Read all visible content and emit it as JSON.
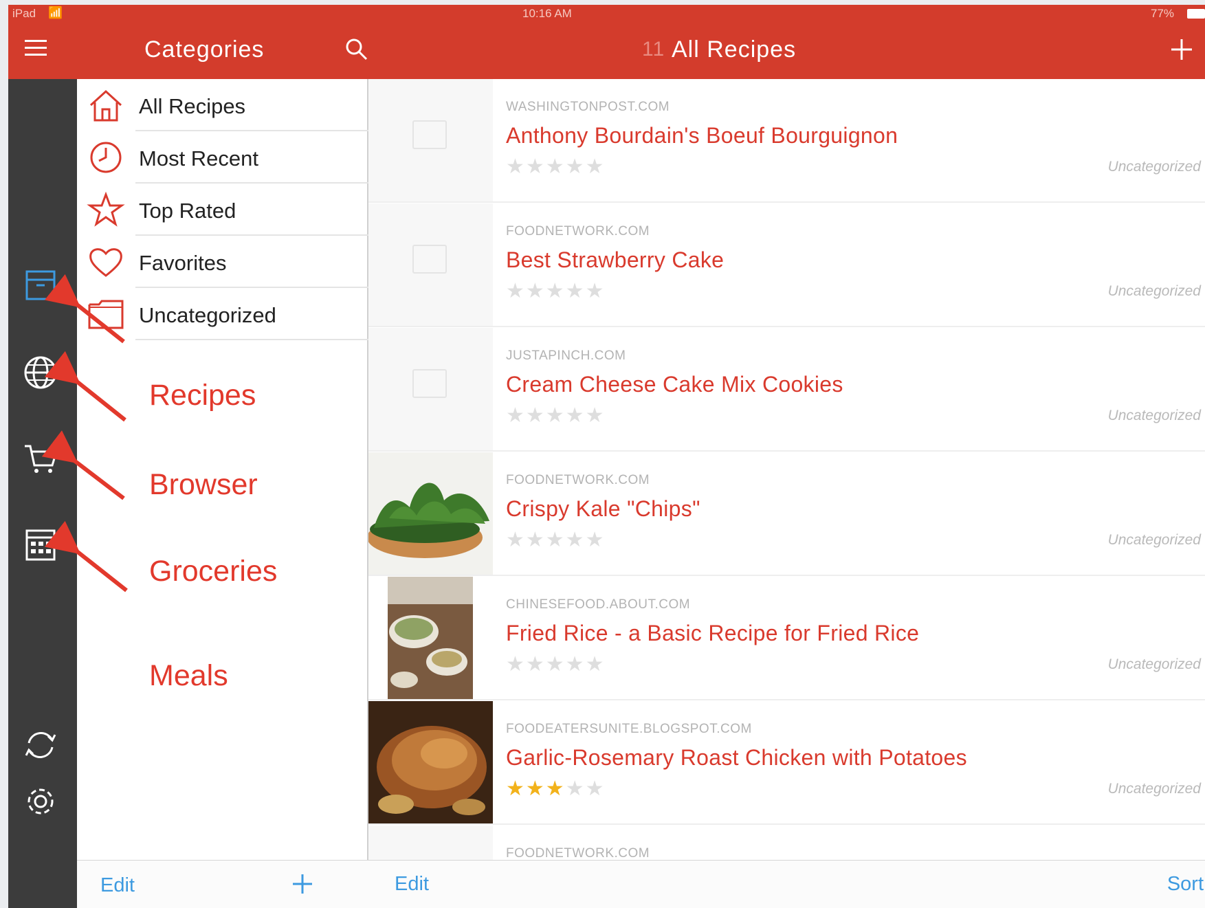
{
  "status_bar": {
    "device": "iPad",
    "time": "10:16 AM",
    "battery": "77%"
  },
  "categories_panel": {
    "title": "Categories",
    "items": [
      {
        "label": "All Recipes",
        "icon": "home-icon"
      },
      {
        "label": "Most Recent",
        "icon": "clock-icon"
      },
      {
        "label": "Top Rated",
        "icon": "star-icon"
      },
      {
        "label": "Favorites",
        "icon": "heart-icon"
      },
      {
        "label": "Uncategorized",
        "icon": "folder-icon"
      }
    ],
    "edit_label": "Edit",
    "add_label": "+"
  },
  "rail": {
    "items": [
      {
        "name": "recipes",
        "icon": "recipe-box-icon"
      },
      {
        "name": "browser",
        "icon": "globe-icon"
      },
      {
        "name": "groceries",
        "icon": "cart-icon"
      },
      {
        "name": "meals",
        "icon": "calendar-icon"
      },
      {
        "name": "sync",
        "icon": "sync-icon"
      },
      {
        "name": "settings",
        "icon": "gear-icon"
      }
    ]
  },
  "annotations": [
    "Recipes",
    "Browser",
    "Groceries",
    "Meals"
  ],
  "main": {
    "count": "11",
    "title": "All Recipes",
    "add_label": "+",
    "edit_label": "Edit",
    "sort_label": "Sort",
    "recipes": [
      {
        "source": "WASHINGTONPOST.COM",
        "title": "Anthony Bourdain's Boeuf Bourguignon",
        "rating": 0,
        "category": "Uncategorized",
        "image": "placeholder"
      },
      {
        "source": "FOODNETWORK.COM",
        "title": "Best Strawberry Cake",
        "rating": 0,
        "category": "Uncategorized",
        "image": "placeholder"
      },
      {
        "source": "JUSTAPINCH.COM",
        "title": "Cream Cheese Cake Mix Cookies",
        "rating": 0,
        "category": "Uncategorized",
        "image": "placeholder"
      },
      {
        "source": "FOODNETWORK.COM",
        "title": "Crispy Kale \"Chips\"",
        "rating": 0,
        "category": "Uncategorized",
        "image": "kale"
      },
      {
        "source": "CHINESEFOOD.ABOUT.COM",
        "title": "Fried Rice - a Basic Recipe for Fried Rice",
        "rating": 0,
        "category": "Uncategorized",
        "image": "rice"
      },
      {
        "source": "FOODEATERSUNITE.BLOGSPOT.COM",
        "title": "Garlic-Rosemary Roast Chicken with Potatoes",
        "rating": 3,
        "category": "Uncategorized",
        "image": "chicken"
      },
      {
        "source": "FOODNETWORK.COM",
        "title": "",
        "rating": 0,
        "category": "",
        "image": "placeholder"
      }
    ]
  },
  "colors": {
    "header": "#d33c2c",
    "rail": "#3c3c3c",
    "accent_text": "#d93a2d",
    "link": "#3d9ae0",
    "star_on": "#f2b21b"
  }
}
